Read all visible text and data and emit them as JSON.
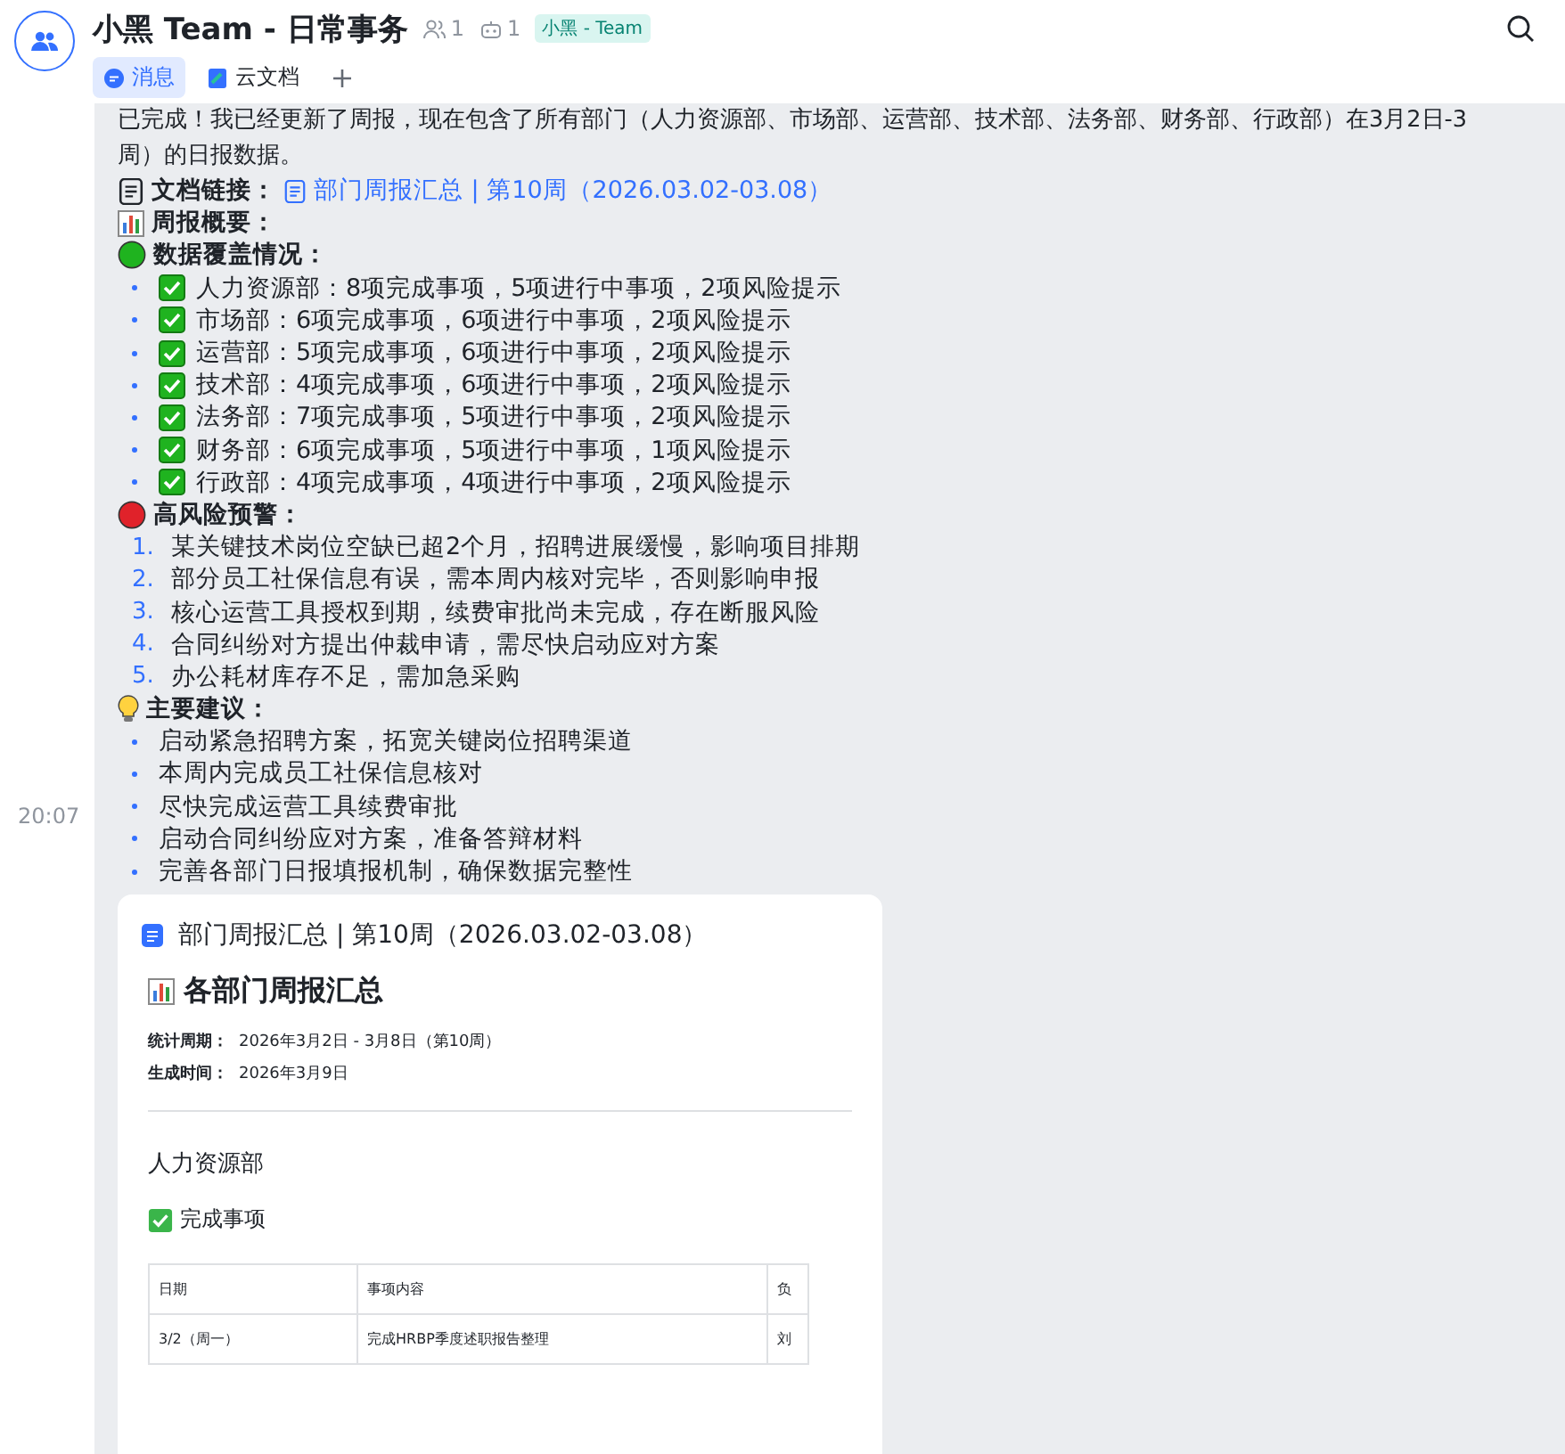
{
  "header": {
    "title": "小黑 Team - 日常事务",
    "member_count": "1",
    "bot_count": "1",
    "tag": "小黑 - Team"
  },
  "tabs": [
    {
      "label": "消息",
      "kind": "message",
      "selected": true
    },
    {
      "label": "云文档",
      "kind": "doc",
      "selected": false
    }
  ],
  "message": {
    "time": "20:07",
    "intro_lines": [
      "已完成！我已经更新了周报，现在包含了所有部门（人力资源部、市场部、运营部、技术部、法务部、财务部、行政部）在3月2日-3",
      "周）的日报数据。"
    ],
    "doc_link": {
      "label": "文档链接：",
      "text": "部门周报汇总 | 第10周（2026.03.02-03.08）"
    },
    "sections": [
      {
        "kind": "overview",
        "title": "周报概要："
      },
      {
        "kind": "coverage",
        "title": "数据覆盖情况：",
        "items": [
          {
            "text": "人力资源部：8项完成事项，5项进行中事项，2项风险提示",
            "checked": true
          },
          {
            "text": "市场部：6项完成事项，6项进行中事项，2项风险提示",
            "checked": true
          },
          {
            "text": "运营部：5项完成事项，6项进行中事项，2项风险提示",
            "checked": true
          },
          {
            "text": "技术部：4项完成事项，6项进行中事项，2项风险提示",
            "checked": true
          },
          {
            "text": "法务部：7项完成事项，5项进行中事项，2项风险提示",
            "checked": true
          },
          {
            "text": "财务部：6项完成事项，5项进行中事项，1项风险提示",
            "checked": true
          },
          {
            "text": "行政部：4项完成事项，4项进行中事项，2项风险提示",
            "checked": true
          }
        ]
      },
      {
        "kind": "risk",
        "title": "高风险预警：",
        "items": [
          {
            "number": "1.",
            "text": "某关键技术岗位空缺已超2个月，招聘进展缓慢，影响项目排期"
          },
          {
            "number": "2.",
            "text": "部分员工社保信息有误，需本周内核对完毕，否则影响申报"
          },
          {
            "number": "3.",
            "text": "核心运营工具授权到期，续费审批尚未完成，存在断服风险"
          },
          {
            "number": "4.",
            "text": "合同纠纷对方提出仲裁申请，需尽快启动应对方案"
          },
          {
            "number": "5.",
            "text": "办公耗材库存不足，需加急采购"
          }
        ]
      },
      {
        "kind": "suggestion",
        "title": "主要建议：",
        "items": [
          {
            "text": "启动紧急招聘方案，拓宽关键岗位招聘渠道"
          },
          {
            "text": "本周内完成员工社保信息核对"
          },
          {
            "text": "尽快完成运营工具续费审批"
          },
          {
            "text": "启动合同纠纷应对方案，准备答辩材料"
          },
          {
            "text": "完善各部门日报填报机制，确保数据完整性"
          }
        ]
      }
    ]
  },
  "card": {
    "title": "部门周报汇总 | 第10周（2026.03.02-03.08）",
    "heading": "各部门周报汇总",
    "meta": [
      {
        "label": "统计周期：",
        "value": "2026年3月2日 - 3月8日（第10周）"
      },
      {
        "label": "生成时间：",
        "value": "2026年3月9日"
      }
    ],
    "department": "人力资源部",
    "subheading": "完成事项",
    "table": {
      "columns": [
        "日期",
        "事项内容",
        "负"
      ],
      "rows": [
        [
          "3/2（周一）",
          "完成HRBP季度述职报告整理",
          "刘"
        ]
      ]
    }
  }
}
